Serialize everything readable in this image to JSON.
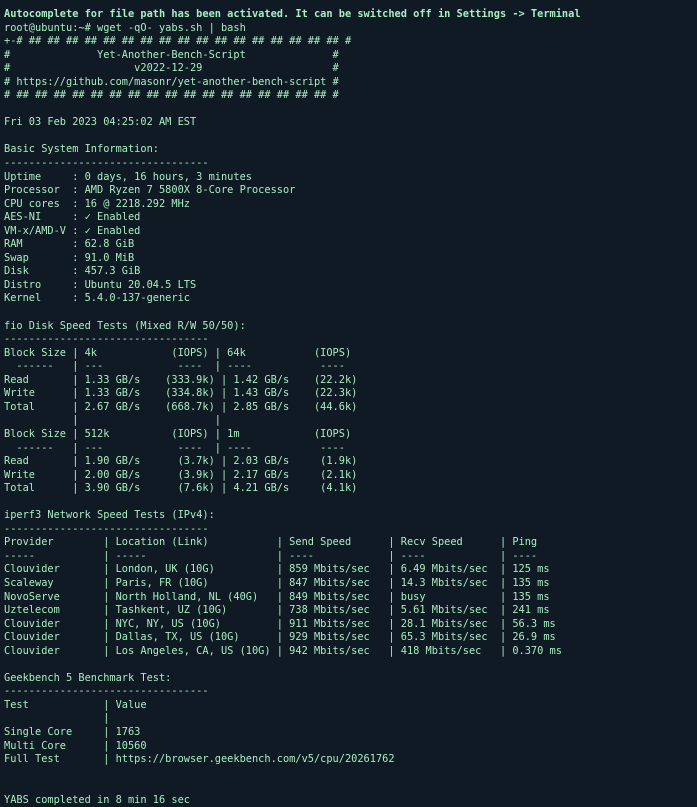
{
  "terminal": {
    "lines": [
      "Autocomplete for file path has been activated. It can be switched off in Settings -> Terminal",
      "root@ubuntu:~# wget -qO- yabs.sh | bash",
      "+-# ## ## ## ## ## ## ## ## ## ## ## ## ## ## ## ## ## #",
      "#              Yet-Another-Bench-Script              #",
      "#                    v2022-12-29                     #",
      "# https://github.com/masonr/yet-another-bench-script #",
      "# ## ## ## ## ## ## ## ## ## ## ## ## ## ## ## ## ## #",
      "",
      "Fri 03 Feb 2023 04:25:02 AM EST",
      "",
      "Basic System Information:",
      "---------------------------------",
      "Uptime     : 0 days, 16 hours, 3 minutes",
      "Processor  : AMD Ryzen 7 5800X 8-Core Processor",
      "CPU cores  : 16 @ 2218.292 MHz",
      "AES-NI     : ✓ Enabled",
      "VM-x/AMD-V : ✓ Enabled",
      "RAM        : 62.8 GiB",
      "Swap       : 91.0 MiB",
      "Disk       : 457.3 GiB",
      "Distro     : Ubuntu 20.04.5 LTS",
      "Kernel     : 5.4.0-137-generic",
      "",
      "fio Disk Speed Tests (Mixed R/W 50/50):",
      "---------------------------------",
      "Block Size | 4k            (IOPS) | 64k           (IOPS)",
      "  ------   | ---            ----  | ----           ----",
      "Read       | 1.33 GB/s    (333.9k) | 1.42 GB/s    (22.2k)",
      "Write      | 1.33 GB/s    (334.8k) | 1.43 GB/s    (22.3k)",
      "Total      | 2.67 GB/s    (668.7k) | 2.85 GB/s    (44.6k)",
      "           |                      |",
      "Block Size | 512k          (IOPS) | 1m            (IOPS)",
      "  ------   | ---            ----  | ----           ----",
      "Read       | 1.90 GB/s      (3.7k) | 2.03 GB/s     (1.9k)",
      "Write      | 2.00 GB/s      (3.9k) | 2.17 GB/s     (2.1k)",
      "Total      | 3.90 GB/s      (7.6k) | 4.21 GB/s     (4.1k)",
      "",
      "iperf3 Network Speed Tests (IPv4):",
      "---------------------------------",
      "Provider        | Location (Link)           | Send Speed      | Recv Speed      | Ping",
      "-----           | -----                     | ----            | ----            | ----",
      "Clouvider       | London, UK (10G)          | 859 Mbits/sec   | 6.49 Mbits/sec  | 125 ms",
      "Scaleway        | Paris, FR (10G)           | 847 Mbits/sec   | 14.3 Mbits/sec  | 135 ms",
      "NovoServe       | North Holland, NL (40G)   | 849 Mbits/sec   | busy            | 135 ms",
      "Uztelecom       | Tashkent, UZ (10G)        | 738 Mbits/sec   | 5.61 Mbits/sec  | 241 ms",
      "Clouvider       | NYC, NY, US (10G)         | 911 Mbits/sec   | 28.1 Mbits/sec  | 56.3 ms",
      "Clouvider       | Dallas, TX, US (10G)      | 929 Mbits/sec   | 65.3 Mbits/sec  | 26.9 ms",
      "Clouvider       | Los Angeles, CA, US (10G) | 942 Mbits/sec   | 418 Mbits/sec   | 0.370 ms",
      "",
      "Geekbench 5 Benchmark Test:",
      "---------------------------------",
      "Test            | Value",
      "                |",
      "Single Core     | 1763",
      "Multi Core      | 10560",
      "Full Test       | https://browser.geekbench.com/v5/cpu/20261762",
      "",
      "",
      "YABS completed in 8 min 16 sec"
    ]
  }
}
